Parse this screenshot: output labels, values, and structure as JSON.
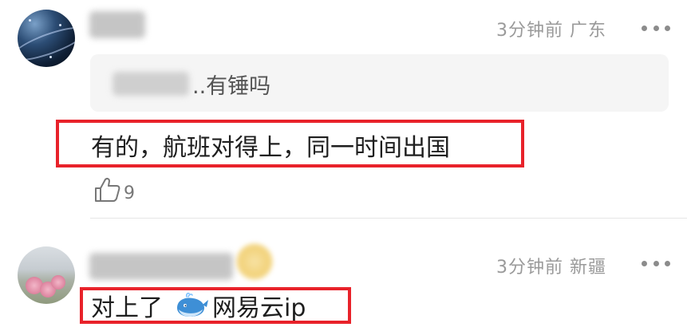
{
  "comments": [
    {
      "username": "",
      "time": "3分钟前",
      "location": "广东",
      "quote": {
        "user": "",
        "text": "..有锤吗"
      },
      "text": "有的，航班对得上，同一时间出国",
      "likes": "9"
    },
    {
      "username": "",
      "time": "3分钟前",
      "location": "新疆",
      "text_before_icon": "对上了",
      "text_after_icon": "网易云ip",
      "icon": "whale-icon"
    }
  ],
  "colors": {
    "highlight": "#e8222a",
    "meta": "#9a9a9a",
    "quote_bg": "#f5f5f5"
  }
}
